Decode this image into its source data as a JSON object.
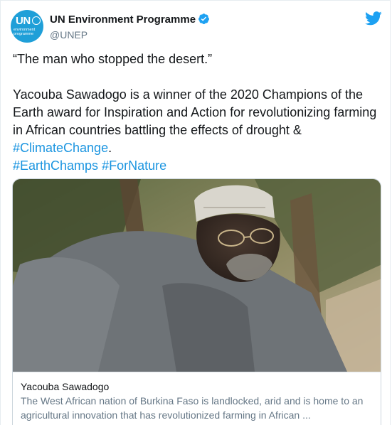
{
  "account": {
    "display_name": "UN Environment Programme",
    "handle": "@UNEP",
    "avatar_text_top": "UN",
    "avatar_text_bottom": "environment programme",
    "verified_color": "#1da1f2",
    "brand_color": "#1f9fd8"
  },
  "tweet": {
    "quote": "“The man who stopped the desert.”",
    "body": "Yacouba Sawadogo is a winner of the 2020 Champions of the Earth award for Inspiration and Action for revolutionizing farming in African countries battling the effects of drought & ",
    "hashtag_inline": "#ClimateChange",
    "after_inline": ".",
    "hashtags": [
      "#EarthChamps",
      "#ForNature"
    ],
    "link_color": "#1b95e0"
  },
  "card": {
    "title": "Yacouba Sawadogo",
    "description": "The West African nation of Burkina Faso is landlocked, arid and is home to an agricultural innovation that has revolutionized farming in African ..."
  },
  "icons": {
    "verified": "verified-badge-icon",
    "twitter": "twitter-bird-icon"
  }
}
